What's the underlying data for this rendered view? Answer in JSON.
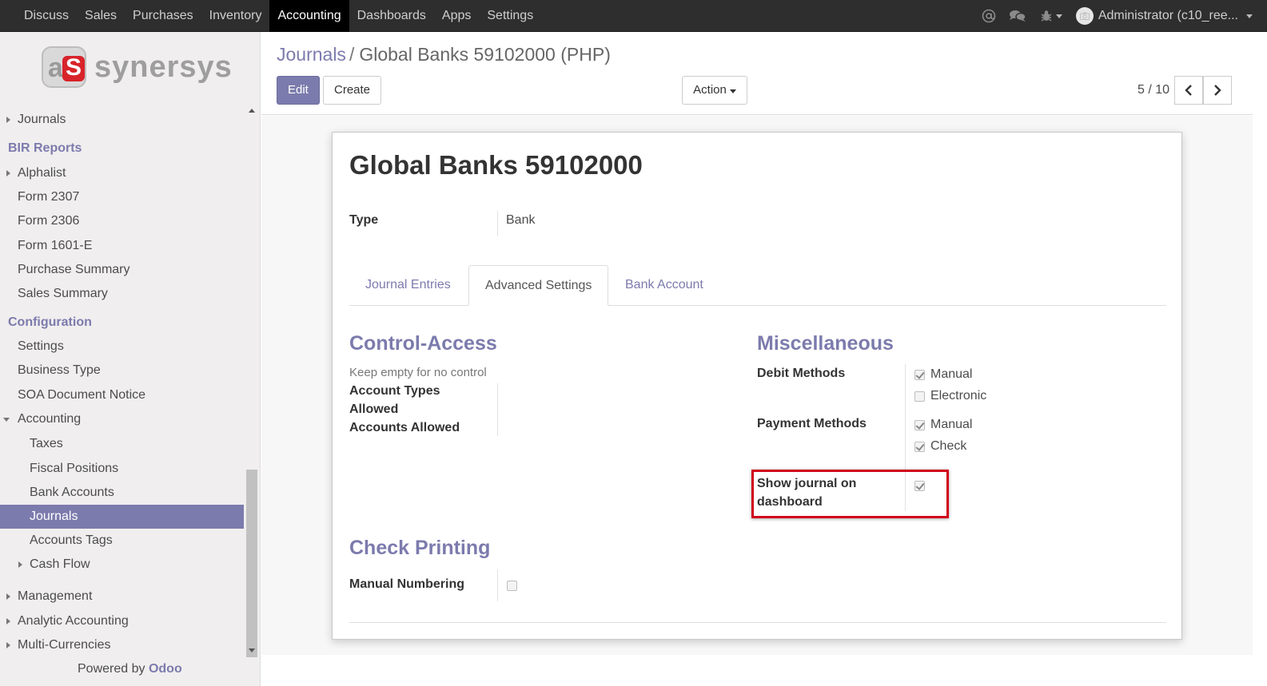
{
  "topbar": {
    "menu": [
      "Discuss",
      "Sales",
      "Purchases",
      "Inventory",
      "Accounting",
      "Dashboards",
      "Apps",
      "Settings"
    ],
    "active_menu": "Accounting",
    "user_name": "Administrator (c10_ree..."
  },
  "sidebar": {
    "logo_text": "synersys",
    "items": {
      "journals_top": "Journals",
      "bir_reports": "BIR Reports",
      "alphalist": "Alphalist",
      "form_2307": "Form 2307",
      "form_2306": "Form 2306",
      "form_1601e": "Form 1601-E",
      "purchase_summary": "Purchase Summary",
      "sales_summary": "Sales Summary",
      "configuration": "Configuration",
      "settings": "Settings",
      "business_type": "Business Type",
      "soa_document_notice": "SOA Document Notice",
      "accounting": "Accounting",
      "taxes": "Taxes",
      "fiscal_positions": "Fiscal Positions",
      "bank_accounts": "Bank Accounts",
      "journals": "Journals",
      "accounts_tags": "Accounts Tags",
      "cash_flow": "Cash Flow",
      "management": "Management",
      "analytic_accounting": "Analytic Accounting",
      "multi_currencies": "Multi-Currencies"
    },
    "powered_by": "Powered by",
    "powered_brand": "Odoo"
  },
  "control": {
    "breadcrumb_link": "Journals",
    "breadcrumb_sep": "/",
    "breadcrumb_current": "Global Banks 59102000 (PHP)",
    "edit_label": "Edit",
    "create_label": "Create",
    "action_label": "Action",
    "pager": "5 / 10"
  },
  "form": {
    "title": "Global Banks 59102000",
    "type_label": "Type",
    "type_value": "Bank",
    "tabs": [
      "Journal Entries",
      "Advanced Settings",
      "Bank Account"
    ],
    "active_tab": "Advanced Settings",
    "control_access": {
      "title": "Control-Access",
      "help": "Keep empty for no control",
      "account_types_label_1": "Account Types",
      "account_types_label_2": "Allowed",
      "accounts_allowed_label": "Accounts Allowed"
    },
    "misc": {
      "title": "Miscellaneous",
      "debit_methods_label": "Debit Methods",
      "debit_manual": "Manual",
      "debit_manual_checked": true,
      "debit_electronic": "Electronic",
      "debit_electronic_checked": false,
      "payment_methods_label": "Payment Methods",
      "payment_manual": "Manual",
      "payment_manual_checked": true,
      "payment_check": "Check",
      "payment_check_checked": true,
      "show_journal_label_1": "Show journal on",
      "show_journal_label_2": "dashboard",
      "show_journal_checked": true
    },
    "check_printing": {
      "title": "Check Printing",
      "manual_numbering_label": "Manual Numbering",
      "manual_numbering_checked": false
    }
  },
  "colors": {
    "accent": "#7c7bad",
    "topbar": "#2e2e2e",
    "highlight_box": "#d0021b"
  }
}
